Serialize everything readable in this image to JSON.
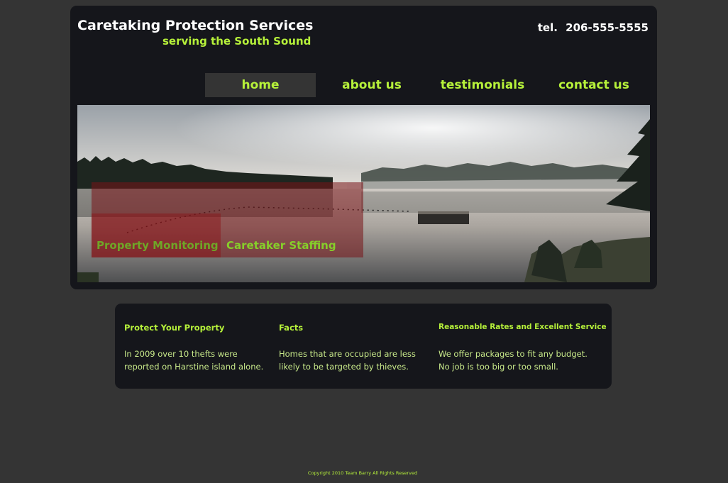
{
  "header": {
    "title": "Caretaking Protection Services",
    "tagline": "serving the South Sound",
    "phone_label": "tel.",
    "phone_number": "206-555-5555"
  },
  "nav": {
    "items": [
      {
        "label": "home",
        "active": true
      },
      {
        "label": "about us",
        "active": false
      },
      {
        "label": "testimonials",
        "active": false
      },
      {
        "label": "contact us",
        "active": false
      }
    ]
  },
  "hero": {
    "tabs": [
      "Property Monitoring",
      "Caretaker Staffing"
    ]
  },
  "info": {
    "columns": [
      {
        "heading": "Protect Your Property",
        "lines": [
          "In 2009 over 10 thefts were",
          "reported on Harstine island alone."
        ]
      },
      {
        "heading": "Facts",
        "lines": [
          "Homes that are occupied are less",
          "likely to be targeted by thieves."
        ]
      },
      {
        "heading": "Reasonable Rates and Excellent Service",
        "lines": [
          "We offer packages to fit any budget.",
          "No job is too big or too small."
        ]
      }
    ]
  },
  "footer": {
    "copyright": "Copyright 2010 Team Barry   All Rights Reserved"
  },
  "colors": {
    "background": "#343434",
    "panel": "#15161b",
    "accent": "#b6f13a",
    "title": "#ffffff"
  }
}
